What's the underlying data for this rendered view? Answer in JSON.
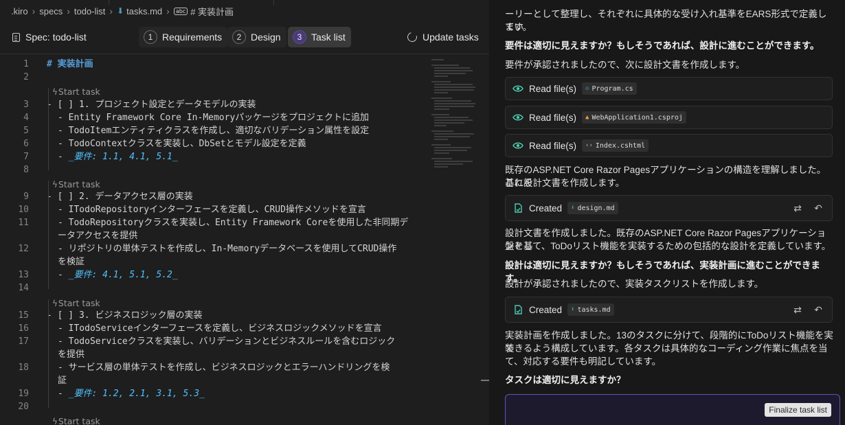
{
  "breadcrumb": {
    "items": [
      ".kiro",
      "specs",
      "todo-list",
      "tasks.md",
      "# 実装計画"
    ]
  },
  "spec_bar": {
    "title": "Spec: todo-list",
    "tabs": [
      {
        "num": "1",
        "label": "Requirements",
        "active": false
      },
      {
        "num": "2",
        "label": "Design",
        "active": false
      },
      {
        "num": "3",
        "label": "Task list",
        "active": true
      }
    ],
    "update_label": "Update tasks"
  },
  "editor": {
    "codelens_label": "Start task",
    "lines": [
      {
        "n": "1",
        "text": "# 実装計画"
      },
      {
        "n": "2",
        "text": ""
      },
      {
        "n": "3",
        "text": "- [ ] 1. プロジェクト設定とデータモデルの実装"
      },
      {
        "n": "4",
        "text": "- Entity Framework Core In-Memoryパッケージをプロジェクトに追加"
      },
      {
        "n": "5",
        "text": "- TodoItemエンティティクラスを作成し、適切なバリデーション属性を設定"
      },
      {
        "n": "6",
        "text": "- TodoContextクラスを実装し、DbSetとモデル設定を定義"
      },
      {
        "n": "7",
        "dash": "- ",
        "req": "_要件: 1.1, 4.1, 5.1_"
      },
      {
        "n": "8",
        "text": ""
      },
      {
        "n": "9",
        "text": "- [ ] 2. データアクセス層の実装"
      },
      {
        "n": "10",
        "text": "- ITodoRepositoryインターフェースを定義し、CRUD操作メソッドを宣言"
      },
      {
        "n": "11",
        "text": "- TodoRepositoryクラスを実装し、Entity Framework Coreを使用した非同期デ",
        "cont": "ータアクセスを提供"
      },
      {
        "n": "12",
        "text": "- リポジトリの単体テストを作成し、In-Memoryデータベースを使用してCRUD操作",
        "cont": "を検証"
      },
      {
        "n": "13",
        "dash": "- ",
        "req": "_要件: 4.1, 5.1, 5.2_"
      },
      {
        "n": "14",
        "text": ""
      },
      {
        "n": "15",
        "text": "- [ ] 3. ビジネスロジック層の実装"
      },
      {
        "n": "16",
        "text": "- ITodoServiceインターフェースを定義し、ビジネスロジックメソッドを宣言"
      },
      {
        "n": "17",
        "text": "- TodoServiceクラスを実装し、バリデーションとビジネスルールを含むロジック",
        "cont": "を提供"
      },
      {
        "n": "18",
        "text": "- サービス層の単体テストを作成し、ビジネスロジックとエラーハンドリングを検",
        "cont": "証"
      },
      {
        "n": "19",
        "dash": "- ",
        "req": "_要件: 1.2, 2.1, 3.1, 5.3_"
      },
      {
        "n": "20",
        "text": ""
      }
    ]
  },
  "chat": {
    "msg_top_1": "ーリーとして整理し、それぞれに具体的な受け入れ基準をEARS形式で定義してい",
    "msg_top_2": "ます。",
    "q_requirements": "要件は適切に見えますか？もしそうであれば、設計に進むことができます。",
    "msg_approved_req": "要件が承認されましたので、次に設計文書を作成します。",
    "read_label": "Read file(s)",
    "read_files": [
      "Program.cs",
      "WebApplication1.csproj",
      "Index.cshtml"
    ],
    "msg_understood_1": "既存のASP.NET Core Razor Pagesアプリケーションの構造を理解しました。これを",
    "msg_understood_2": "基に設計文書を作成します。",
    "created_label": "Created",
    "created_design": "design.md",
    "msg_design_1": "設計文書を作成しました。既存のASP.NET Core Razor Pagesアプリケーションを基",
    "msg_design_2": "盤として、ToDoリスト機能を実装するための包括的な設計を定義しています。",
    "q_design": "設計は適切に見えますか？もしそうであれば、実装計画に進むことができます。",
    "msg_approved_design": "設計が承認されましたので、実装タスクリストを作成します。",
    "created_tasks": "tasks.md",
    "msg_plan_1": "実装計画を作成しました。13のタスクに分けて、段階的にToDoリスト機能を実装",
    "msg_plan_2": "できるよう構成しています。各タスクは具体的なコーディング作業に焦点を当",
    "msg_plan_3": "て、対応する要件も明記しています。",
    "q_tasks": "タスクは適切に見えますか？",
    "finalize_label": "Finalize task list"
  },
  "colors": {
    "accent_purple": "#6b4fbb",
    "heading_blue": "#569cd6",
    "requirement_cyan": "#4fc1ff",
    "icon_green": "#4ec9b0"
  }
}
